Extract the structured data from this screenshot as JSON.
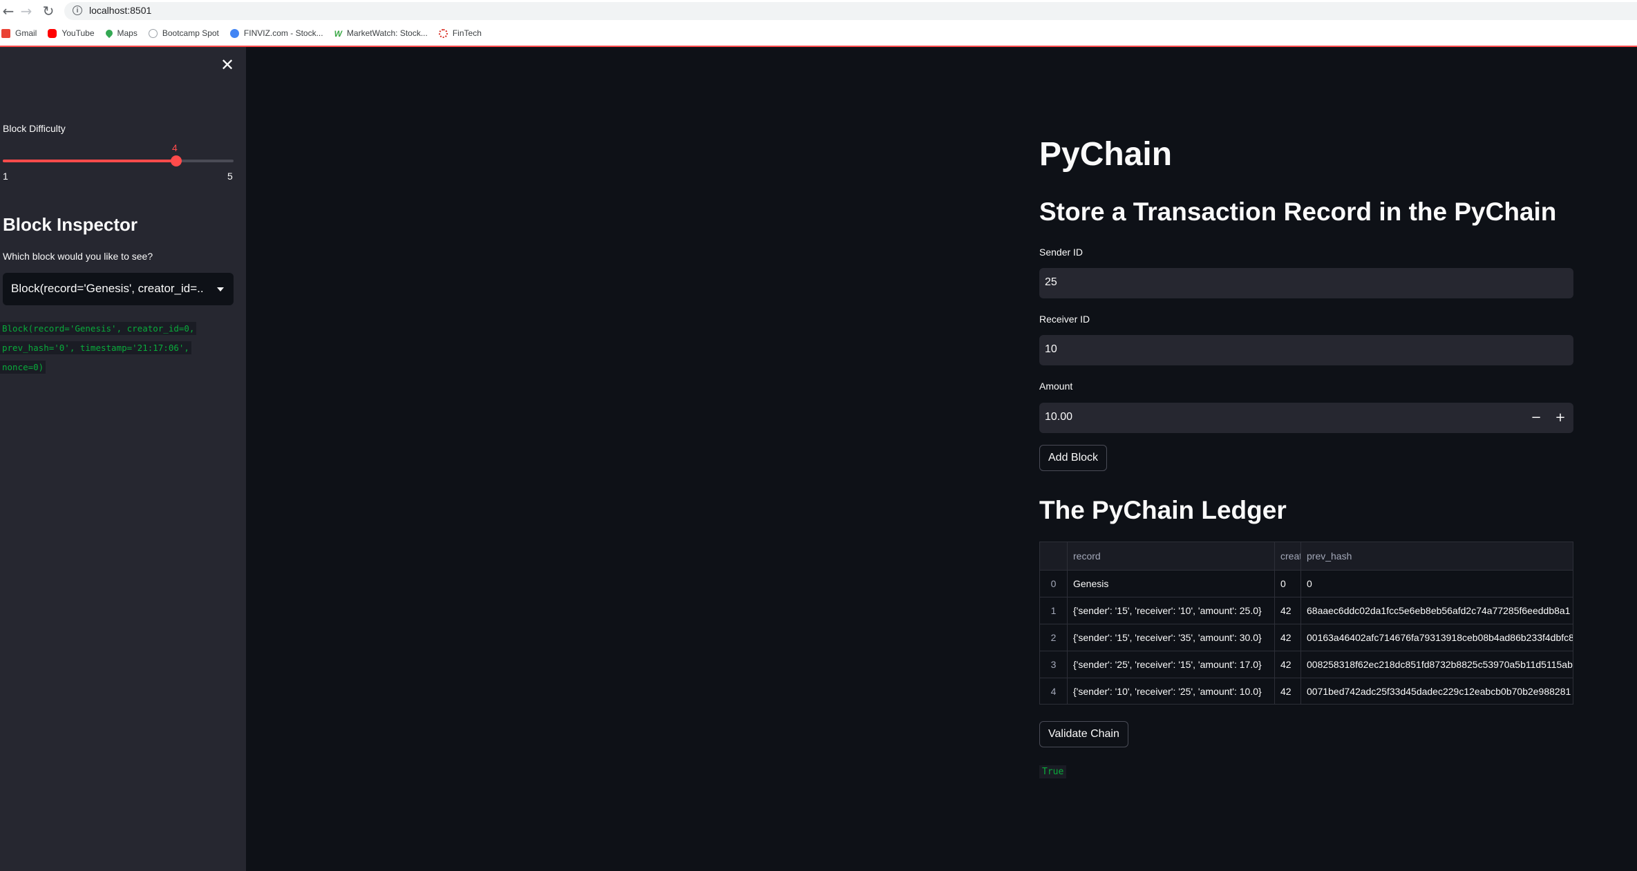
{
  "browser": {
    "url": "localhost:8501",
    "bookmarks": [
      {
        "label": "Gmail",
        "icon": "gmail-icon",
        "color": "#ea4335"
      },
      {
        "label": "YouTube",
        "icon": "youtube-icon",
        "color": "#ff0000"
      },
      {
        "label": "Maps",
        "icon": "maps-icon",
        "color": "#34a853"
      },
      {
        "label": "Bootcamp Spot",
        "icon": "globe-icon",
        "color": "#9aa0a6"
      },
      {
        "label": "FINVIZ.com - Stock...",
        "icon": "finviz-icon",
        "color": "#4285f4"
      },
      {
        "label": "MarketWatch: Stock...",
        "icon": "marketwatch-icon",
        "color": "#3aa845"
      },
      {
        "label": "FinTech",
        "icon": "fintech-icon",
        "color": "#d93025"
      }
    ]
  },
  "sidebar": {
    "difficulty_label": "Block Difficulty",
    "slider": {
      "value": 4,
      "min": 1,
      "max": 5,
      "min_label": "1",
      "max_label": "5",
      "value_label": "4"
    },
    "inspector_title": "Block Inspector",
    "select_label": "Which block would you like to see?",
    "select_value": "Block(record='Genesis', creator_id=...",
    "block_detail": [
      "Block(record='Genesis', creator_id=0,",
      "prev_hash='0', timestamp='21:17:06',",
      "nonce=0)"
    ]
  },
  "main": {
    "title": "PyChain",
    "form_title": "Store a Transaction Record in the PyChain",
    "sender_label": "Sender ID",
    "sender_value": "25",
    "receiver_label": "Receiver ID",
    "receiver_value": "10",
    "amount_label": "Amount",
    "amount_value": "10.00",
    "stepper_minus": "−",
    "stepper_plus": "+",
    "add_button": "Add Block",
    "ledger_title": "The PyChain Ledger",
    "table": {
      "headers": [
        "",
        "record",
        "creat",
        "prev_hash"
      ],
      "rows": [
        [
          "0",
          "Genesis",
          "0",
          "0"
        ],
        [
          "1",
          "{'sender': '15', 'receiver': '10', 'amount': 25.0}",
          "42",
          "68aaec6ddc02da1fcc5e6eb8eb56afd2c74a77285f6eeddb8a1"
        ],
        [
          "2",
          "{'sender': '15', 'receiver': '35', 'amount': 30.0}",
          "42",
          "00163a46402afc714676fa79313918ceb08b4ad86b233f4dbfc8"
        ],
        [
          "3",
          "{'sender': '25', 'receiver': '15', 'amount': 17.0}",
          "42",
          "008258318f62ec218dc851fd8732b8825c53970a5b11d5115ab"
        ],
        [
          "4",
          "{'sender': '10', 'receiver': '25', 'amount': 10.0}",
          "42",
          "0071bed742adc25f33d45dadec229c12eabcb0b70b2e988281"
        ]
      ]
    },
    "validate_button": "Validate Chain",
    "validate_result": "True"
  },
  "colors": {
    "accent": "#ff4b4b",
    "success_text": "#09ab3b",
    "background": "#0e1117",
    "sidebar": "#262730"
  }
}
